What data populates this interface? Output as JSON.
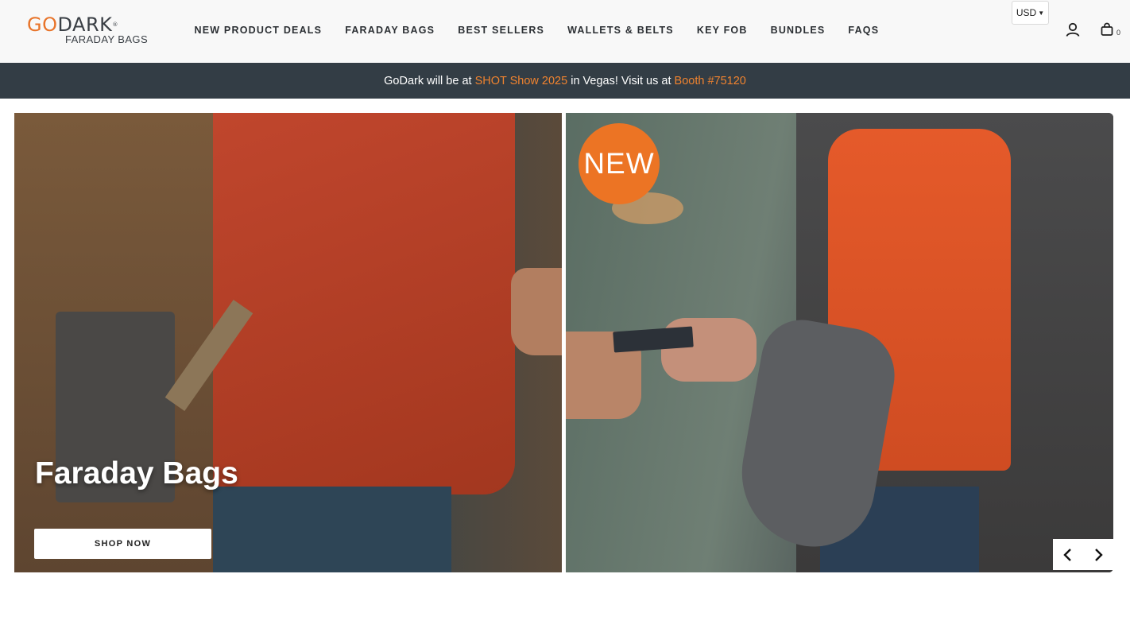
{
  "header": {
    "logo": {
      "go": "GO",
      "dark": "DARK",
      "tm": "®",
      "sub": "FARADAY BAGS"
    },
    "nav": [
      {
        "label": "NEW PRODUCT DEALS"
      },
      {
        "label": "FARADAY BAGS"
      },
      {
        "label": "BEST SELLERS"
      },
      {
        "label": "WALLETS & BELTS"
      },
      {
        "label": "KEY FOB"
      },
      {
        "label": "BUNDLES"
      },
      {
        "label": "FAQS"
      }
    ],
    "currency": "USD",
    "account_icon": "user-icon",
    "cart_icon": "shopping-bag-icon",
    "cart_count": "0"
  },
  "announcement": {
    "prefix": "GoDark will be at ",
    "event": "SHOT Show 2025",
    "middle": " in Vegas! Visit us at ",
    "booth": "Booth #75120"
  },
  "hero": {
    "left": {
      "title": "Faraday Bags",
      "button": "SHOP NOW",
      "image": "man-in-red-corduroy-jacket-with-backpack-and-faraday-bag"
    },
    "right": {
      "badge": "NEW",
      "image": "woman-with-grey-sling-bag-handing-card"
    },
    "controls": {
      "prev_icon": "chevron-left-icon",
      "next_icon": "chevron-right-icon"
    }
  },
  "colors": {
    "accent": "#ec7424",
    "announcement_bg": "#333d45",
    "header_bg": "#f8f8f8",
    "highlight": "#f0832f"
  }
}
